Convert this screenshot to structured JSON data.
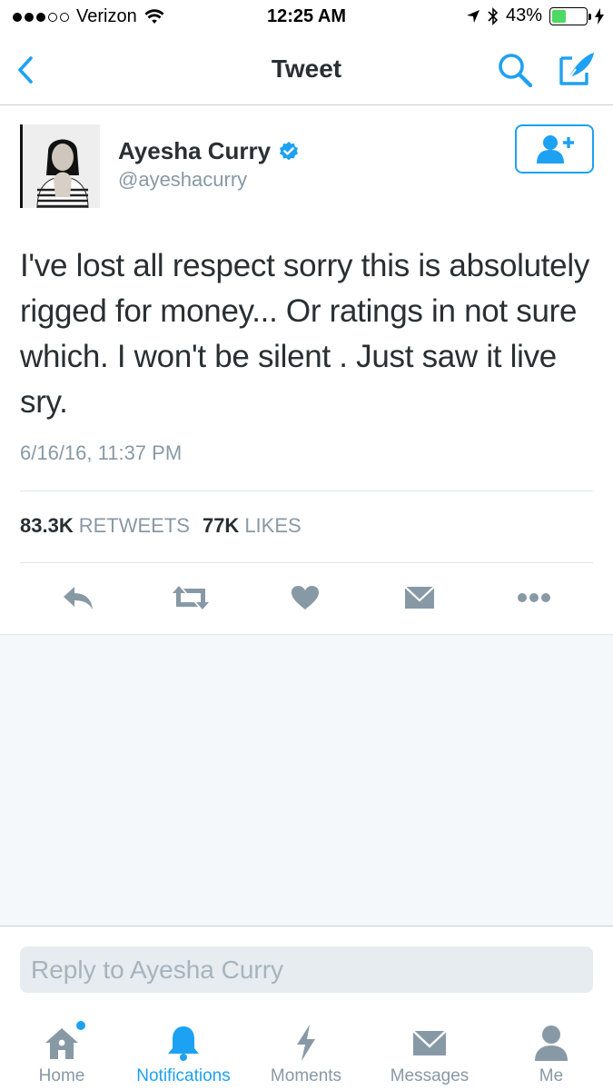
{
  "status_bar": {
    "carrier": "Verizon",
    "time": "12:25 AM",
    "battery_percent": "43%",
    "battery_level": 0.43,
    "signal_dots_filled": 3,
    "signal_dots_total": 5
  },
  "nav": {
    "title": "Tweet",
    "back_icon": "chevron-left-icon",
    "search_icon": "search-icon",
    "compose_icon": "compose-icon"
  },
  "tweet": {
    "display_name": "Ayesha Curry",
    "verified": true,
    "handle": "@ayeshacurry",
    "text": "I've lost all respect sorry this is absolutely rigged for money... Or ratings in not sure which. I won't be silent . Just saw it live sry.",
    "date": "6/16/16, 11:37 PM",
    "retweets_count": "83.3K",
    "retweets_label": "RETWEETS",
    "likes_count": "77K",
    "likes_label": "LIKES"
  },
  "reply": {
    "placeholder": "Reply to Ayesha Curry"
  },
  "tabs": [
    {
      "label": "Home",
      "icon": "home-icon",
      "active": false
    },
    {
      "label": "Notifications",
      "icon": "bell-icon",
      "active": true
    },
    {
      "label": "Moments",
      "icon": "lightning-icon",
      "active": false
    },
    {
      "label": "Messages",
      "icon": "envelope-icon",
      "active": false
    },
    {
      "label": "Me",
      "icon": "person-icon",
      "active": false
    }
  ],
  "colors": {
    "accent": "#1da1f2",
    "muted": "#8899a6",
    "battery": "#4cd964"
  }
}
